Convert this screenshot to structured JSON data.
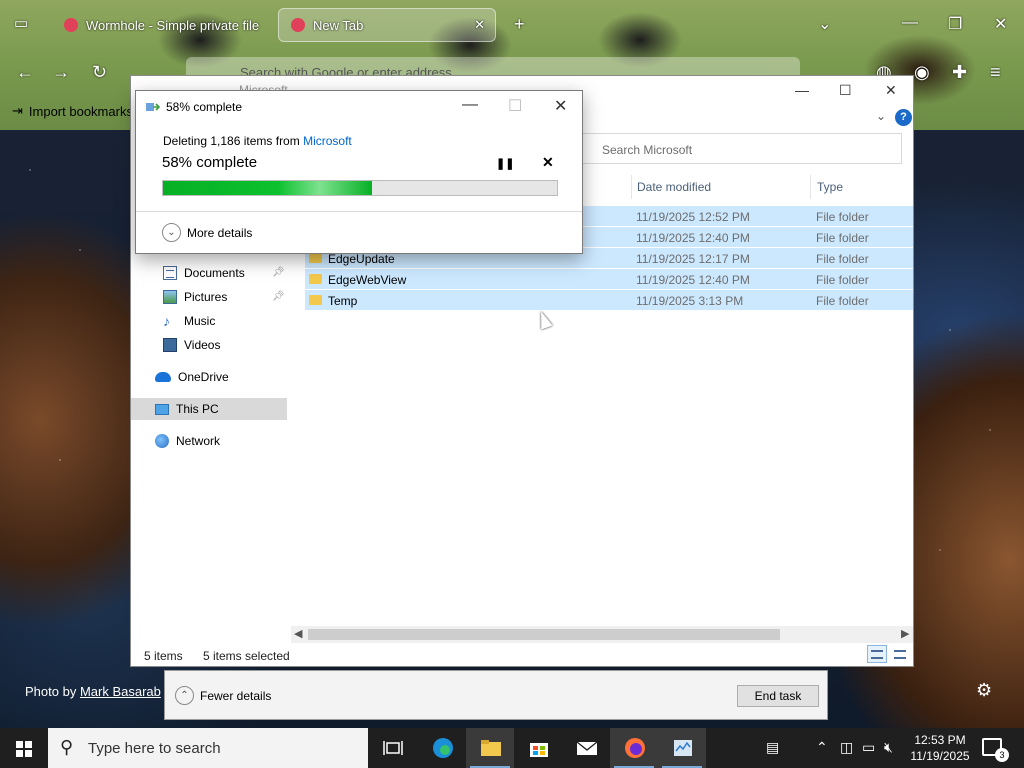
{
  "browser": {
    "tabs": [
      {
        "label": "Wormhole - Simple private file"
      },
      {
        "label": "New Tab"
      }
    ],
    "new_tab_glyph": "+",
    "url_placeholder": "Search with Google or enter address",
    "bookmarks_label": "Import bookmarks..."
  },
  "explorer": {
    "title": "Microsoft",
    "search_placeholder": "Search Microsoft",
    "columns": {
      "date": "Date modified",
      "type": "Type"
    },
    "nav": {
      "documents": "Documents",
      "pictures": "Pictures",
      "music": "Music",
      "videos": "Videos",
      "onedrive": "OneDrive",
      "this_pc": "This PC",
      "network": "Network"
    },
    "rows": [
      {
        "name": "",
        "date": "11/19/2025 12:52 PM",
        "type": "File folder"
      },
      {
        "name": "",
        "date": "11/19/2025 12:40 PM",
        "type": "File folder"
      },
      {
        "name": "EdgeUpdate",
        "date": "11/19/2025 12:17 PM",
        "type": "File folder"
      },
      {
        "name": "EdgeWebView",
        "date": "11/19/2025 12:40 PM",
        "type": "File folder"
      },
      {
        "name": "Temp",
        "date": "11/19/2025 3:13 PM",
        "type": "File folder"
      }
    ],
    "status": {
      "items": "5 items",
      "selected": "5 items selected"
    }
  },
  "progress_dialog": {
    "title": "58% complete",
    "line_prefix": "Deleting 1,186 items from",
    "line_link": "Microsoft",
    "percent_text": "58% complete",
    "progress": 0.53,
    "more_details": "More details",
    "pause_glyph": "❚❚",
    "cancel_glyph": "✕"
  },
  "task_manager": {
    "fewer_details": "Fewer details",
    "end_task": "End task"
  },
  "desktop": {
    "credit_prefix": "Photo by",
    "credit_author": "Mark Basarab"
  },
  "taskbar": {
    "search_placeholder": "Type here to search",
    "clock_time": "12:53 PM",
    "clock_date": "11/19/2025",
    "notification_count": "3"
  },
  "colors": {
    "progress_green": "#06b025",
    "selection": "#cce8ff",
    "taskbar": "#1f1f1f",
    "link": "#0066cc"
  },
  "icons": [
    "close-icon",
    "minimize-icon",
    "maximize-icon",
    "folder-icon",
    "pin-icon",
    "cloud-icon",
    "pc-icon",
    "network-icon",
    "windows-logo-icon",
    "search-icon",
    "gear-icon",
    "pause-icon"
  ]
}
